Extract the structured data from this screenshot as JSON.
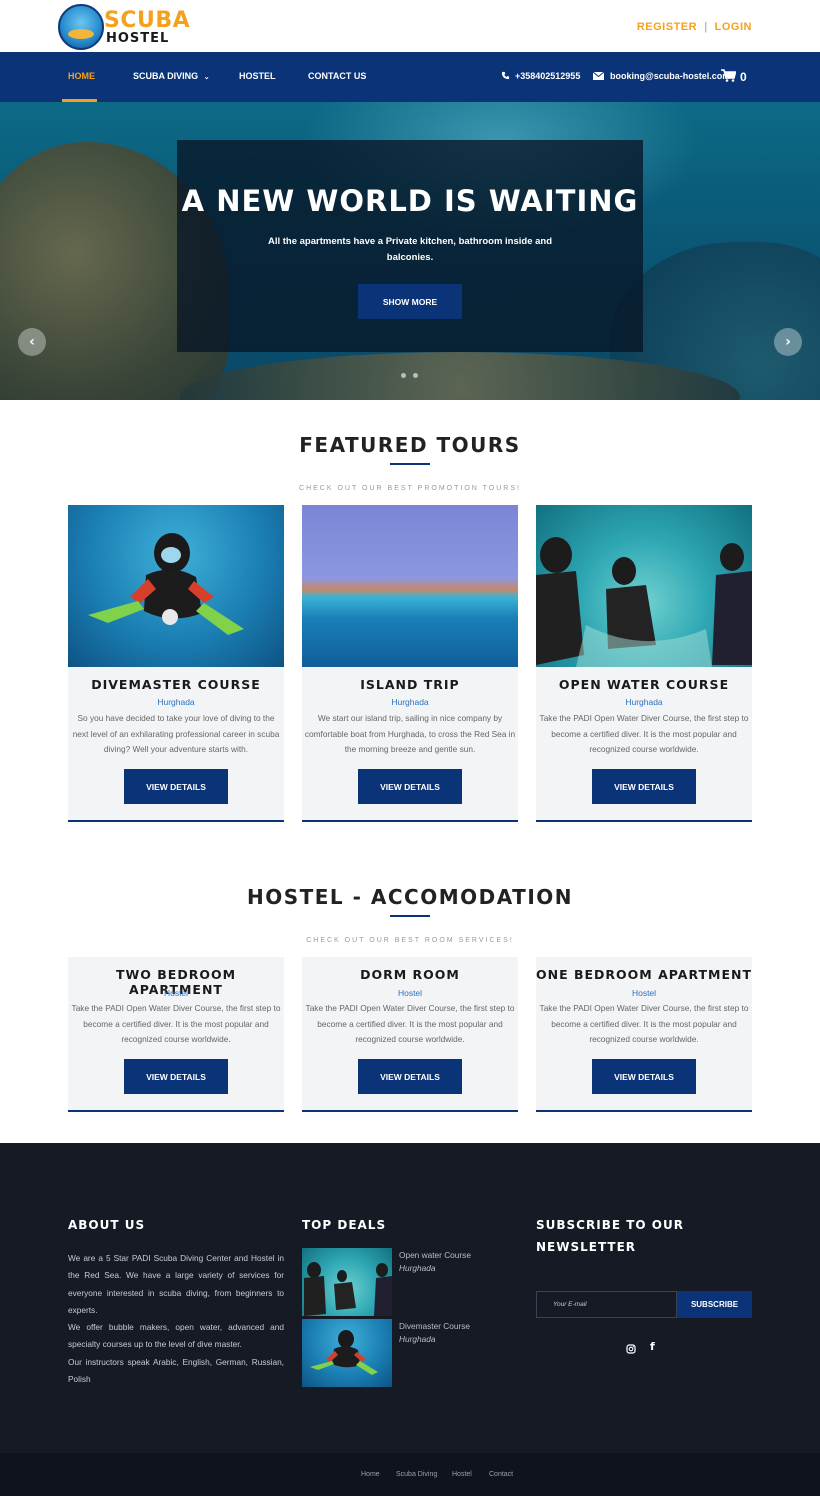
{
  "header": {
    "brand_top": "SCUBA",
    "brand_bottom": "HOSTEL",
    "register": "REGISTER",
    "login": "LOGIN",
    "separator": "|"
  },
  "nav": {
    "items": [
      "HOME",
      "SCUBA DIVING",
      "HOSTEL",
      "CONTACT US"
    ],
    "active": "HOME",
    "phone": "+358402512955",
    "email": "booking@scuba-hostel.com",
    "cart_count": "0"
  },
  "hero": {
    "title": "A NEW WORLD IS WAITING",
    "subtitle": "All the apartments have a Private kitchen, bathroom inside and balconies.",
    "button": "SHOW MORE"
  },
  "tours": {
    "title": "FEATURED TOURS",
    "subtitle": "CHECK OUT OUR BEST PROMOTION TOURS!",
    "items": [
      {
        "title": "DIVEMASTER COURSE",
        "location": "Hurghada",
        "desc": "So you have decided to take your love of diving to the next level of an exhilarating professional career in scuba diving? Well your adventure starts with.",
        "button": "VIEW DETAILS"
      },
      {
        "title": "ISLAND TRIP",
        "location": "Hurghada",
        "desc": "We start our island trip, sailing in nice company by comfortable boat from Hurghada, to cross the Red Sea in the morning breeze and gentle sun.",
        "button": "VIEW DETAILS"
      },
      {
        "title": "OPEN WATER COURSE",
        "location": "Hurghada",
        "desc": "Take the PADI Open Water Diver Course, the first step to become a certified diver. It is the most popular and recognized course worldwide.",
        "button": "VIEW DETAILS"
      }
    ]
  },
  "hostel": {
    "title": "HOSTEL - ACCOMODATION",
    "subtitle": "CHECK OUT OUR BEST ROOM SERVICES!",
    "items": [
      {
        "title": "TWO BEDROOM APARTMENT",
        "location": "Hostel",
        "desc": "Take the PADI Open Water Diver Course, the first step to become a certified diver. It is the most popular and recognized course worldwide.",
        "button": "VIEW DETAILS"
      },
      {
        "title": "DORM ROOM",
        "location": "Hostel",
        "desc": "Take the PADI Open Water Diver Course, the first step to become a certified diver. It is the most popular and recognized course worldwide.",
        "button": "VIEW DETAILS"
      },
      {
        "title": "ONE BEDROOM APARTMENT",
        "location": "Hostel",
        "desc": "Take the PADI Open Water Diver Course, the first step to become a certified diver. It is the most popular and recognized course worldwide.",
        "button": "VIEW DETAILS"
      }
    ]
  },
  "footer": {
    "about_title": "ABOUT US",
    "about_p1": "We are a 5 Star PADI Scuba Diving Center and Hostel in the Red Sea. We have a large variety of services for everyone interested in scuba diving, from beginners to experts.",
    "about_p2": "We offer bubble makers, open water, advanced and specialty courses up to the level of dive master.",
    "about_p3": "Our instructors speak Arabic, English, German, Russian, Polish",
    "deals_title": "TOP DEALS",
    "deals": [
      {
        "name": "Open water Course",
        "location": "Hurghada"
      },
      {
        "name": "Divemaster Course",
        "location": "Hurghada"
      }
    ],
    "newsletter_title_1": "SUBSCRIBE TO OUR",
    "newsletter_title_2": "NEWSLETTER",
    "email_placeholder": "Your E-mail",
    "subscribe": "SUBSCRIBE",
    "social": [
      "instagram-icon",
      "facebook-icon"
    ]
  },
  "bottom_links": [
    "Home",
    "Scuba Diving",
    "Hostel",
    "Contact"
  ],
  "colors": {
    "navy": "#0a3378",
    "accent": "#f4a21e",
    "footer": "#151a24",
    "link": "#2b72c2"
  }
}
